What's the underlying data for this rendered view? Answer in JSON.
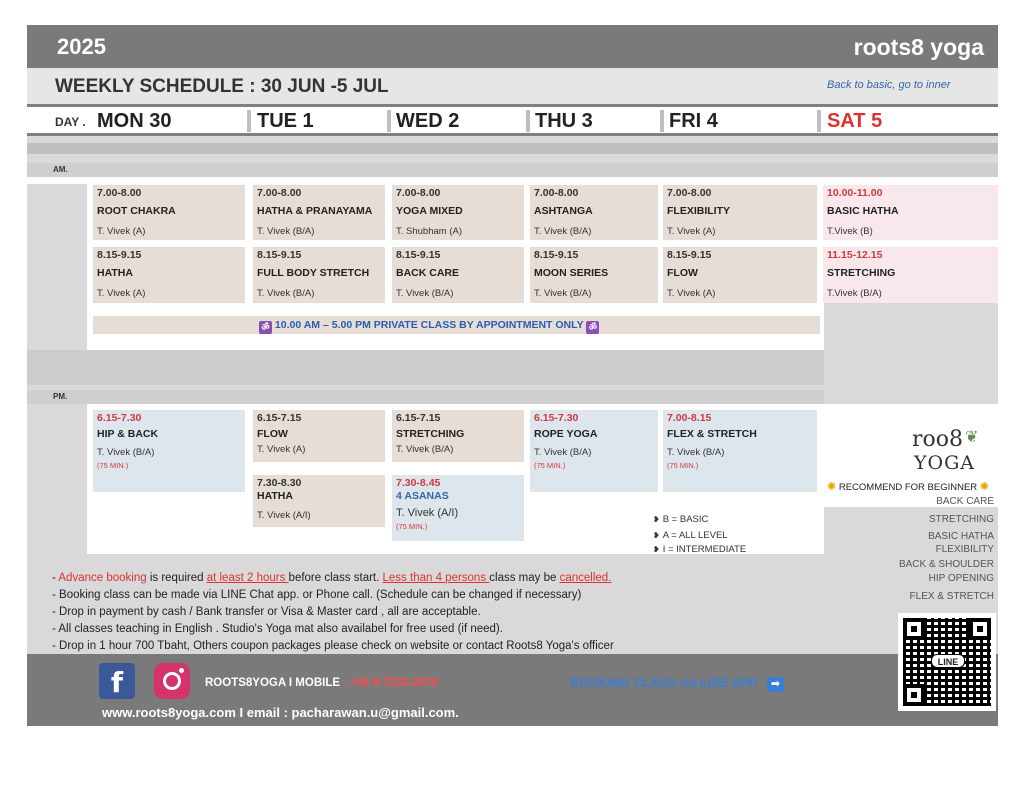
{
  "header": {
    "year": "2025",
    "brand": "roots8 yoga",
    "title": "WEEKLY SCHEDULE  : 30 JUN -5 JUL",
    "tagline": "Back to basic, go to inner"
  },
  "days": {
    "label": "DAY .",
    "mon": "MON 30",
    "tue": "TUE 1",
    "wed": "WED 2",
    "thu": "THU 3",
    "fri": "FRI 4",
    "sat": "SAT 5"
  },
  "am_label": "AM.",
  "pm_label": "PM.",
  "am": {
    "row1": {
      "mon": {
        "time": "7.00-8.00",
        "name": "ROOT CHAKRA",
        "teacher": "T. Vivek (A)"
      },
      "tue": {
        "time": "7.00-8.00",
        "name": "HATHA & PRANAYAMA",
        "teacher": "T. Vivek (B/A)"
      },
      "wed": {
        "time": "7.00-8.00",
        "name": "YOGA MIXED",
        "teacher": "T. Shubham (A)"
      },
      "thu": {
        "time": "7.00-8.00",
        "name": "ASHTANGA",
        "teacher": "T. Vivek (B/A)"
      },
      "fri": {
        "time": "7.00-8.00",
        "name": "FLEXIBILITY",
        "teacher": "T. Vivek (A)"
      },
      "sat": {
        "time": "10.00-11.00",
        "name": "BASIC HATHA",
        "teacher": "T.Vivek   (B)"
      }
    },
    "row2": {
      "mon": {
        "time": "8.15-9.15",
        "name": "HATHA",
        "teacher": "T. Vivek (A)"
      },
      "tue": {
        "time": "8.15-9.15",
        "name": "FULL BODY STRETCH",
        "teacher": "T. Vivek (B/A)"
      },
      "wed": {
        "time": "8.15-9.15",
        "name": "BACK CARE",
        "teacher": "T. Vivek (B/A)"
      },
      "thu": {
        "time": "8.15-9.15",
        "name": "MOON SERIES",
        "teacher": "T. Vivek (B/A)"
      },
      "fri": {
        "time": "8.15-9.15",
        "name": "FLOW",
        "teacher": "T. Vivek (A)"
      },
      "sat": {
        "time": "11.15-12.15",
        "name": "STRETCHING",
        "teacher": "T.Vivek  (B/A)"
      }
    },
    "private": "10.00 AM – 5.00 PM    PRIVATE CLASS BY APPOINTMENT ONLY",
    "om_icon": "ॐ"
  },
  "pm": {
    "row1": {
      "mon": {
        "time": "6.15-7.30",
        "name": "HIP & BACK",
        "teacher": "T. Vivek (B/A)",
        "dur": "(75 MIN.)"
      },
      "tue": {
        "time": "6.15-7.15",
        "name": "FLOW",
        "teacher": "T. Vivek  (A)"
      },
      "wed": {
        "time": "6.15-7.15",
        "name": "STRETCHING",
        "teacher": "T. Vivek (B/A)"
      },
      "thu": {
        "time": "6.15-7.30",
        "name": "ROPE YOGA",
        "teacher": "T. Vivek (B/A)",
        "dur": "(75 MIN.)"
      },
      "fri": {
        "time": "7.00-8.15",
        "name": "FLEX & STRETCH",
        "teacher": "T. Vivek (B/A)",
        "dur": "(75 MIN.)"
      }
    },
    "row2": {
      "tue": {
        "time": "7.30-8.30",
        "name": "HATHA",
        "teacher": "T. Vivek (A/I)"
      },
      "wed": {
        "time": "7.30-8.45",
        "name": "4 ASANAS",
        "teacher": "T. Vivek (A/I)",
        "dur": "(75 MIN.)"
      }
    }
  },
  "legend": {
    "basic": "B = BASIC",
    "all": "A = ALL LEVEL",
    "inter": "I = INTERMEDIATE"
  },
  "recommend": {
    "head": "RECOMMEND FOR BEGINNER",
    "items": [
      "BACK CARE",
      "STRETCHING",
      "BASIC HATHA",
      "FLEXIBILITY",
      "BACK & SHOULDER",
      "HIP OPENING",
      "FLEX & STRETCH"
    ]
  },
  "logo": {
    "top": "roo8",
    "bottom": "YOGA"
  },
  "notes": {
    "l1a": "- ",
    "l1b": "Advance booking",
    "l1c": " is required ",
    "l1d": "at least 2 hours ",
    "l1e": "before class start. ",
    "l1f": "Less than 4 persons ",
    "l1g": "class may be ",
    "l1h": "cancelled.",
    "l2": "- Booking class can be made via LINE Chat app.  or Phone call. (Schedule can be changed if necessary)",
    "l3": "- Drop in payment  by cash / Bank transfer or Visa & Master card , all are acceptable.",
    "l4": "- All classes teaching in English .  Studio's Yoga mat also availabel for free used (if need).",
    "l5": "- Drop in 1 hour 700 Tbaht, Others coupon packages please check on website or contact Roots8 Yoga's officer"
  },
  "footer": {
    "social": "ROOTS8YOGA   I  MOBILE",
    "mobile": " : +66 9-7232-2678",
    "booking": "BOOKING CLASS via LINE APP.",
    "booking_icon": "➡",
    "web": "www.roots8yoga.com  I email : pacharawan.u@gmail.com.",
    "qr_label": "LINE",
    "fb_glyph": "f"
  }
}
